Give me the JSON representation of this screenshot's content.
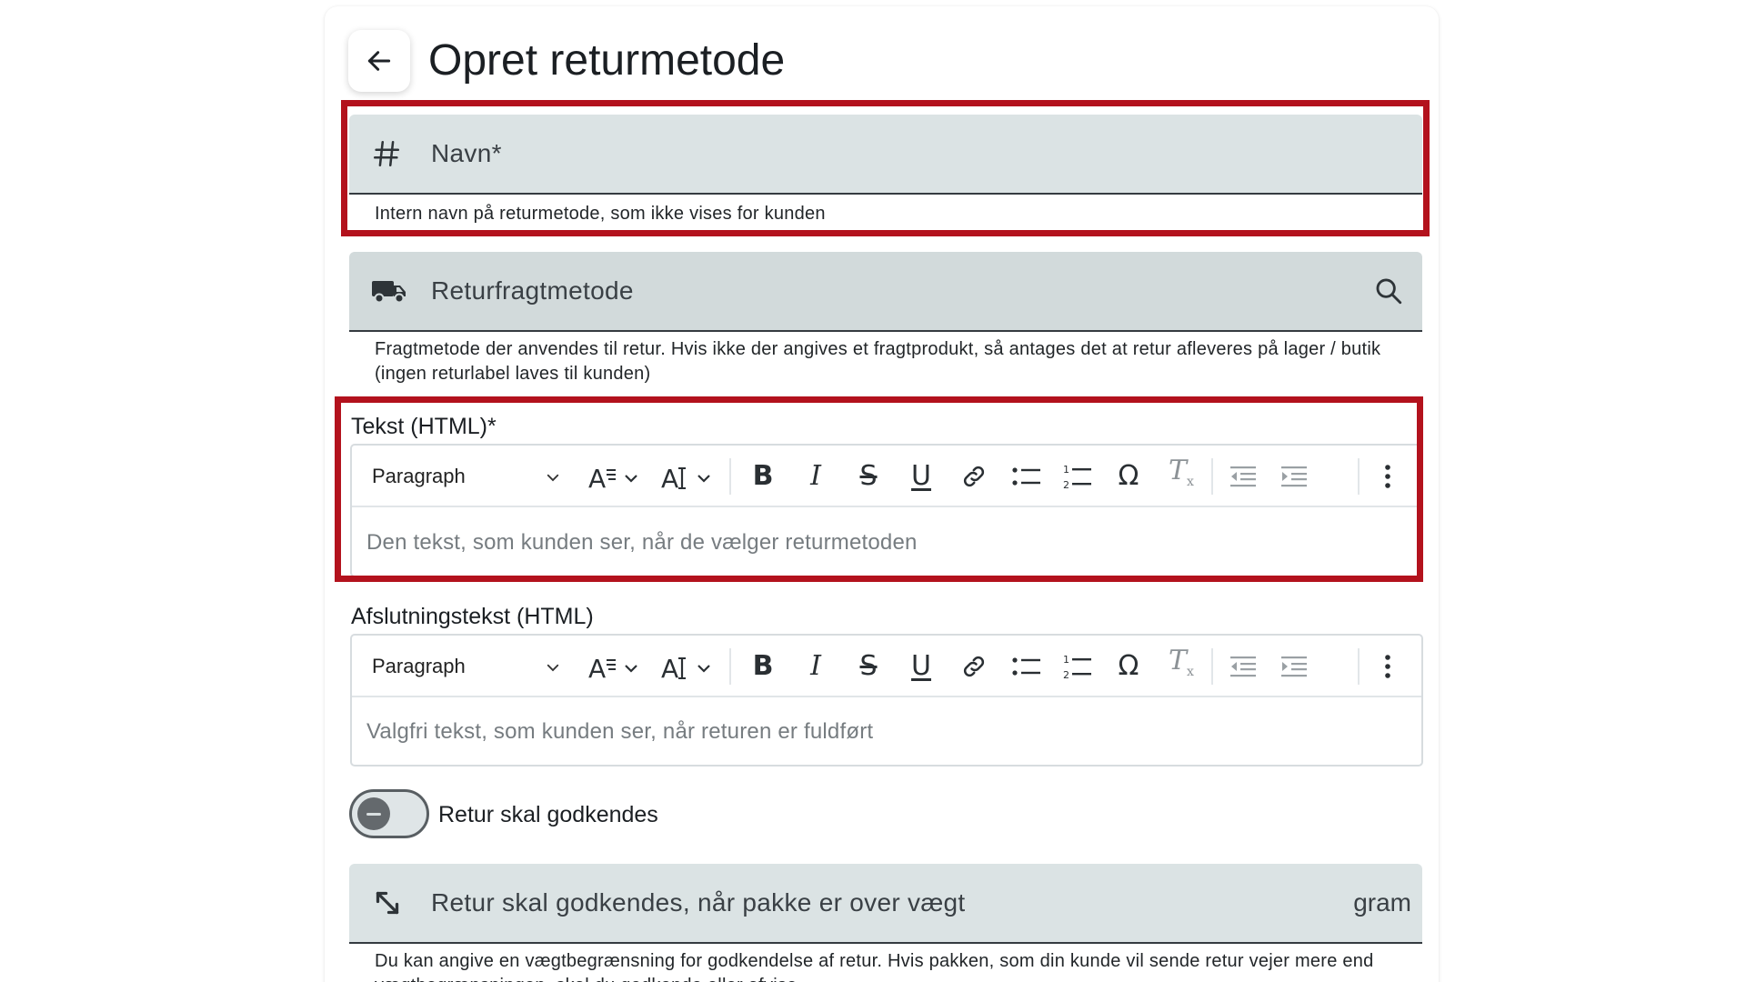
{
  "header": {
    "title": "Opret returmetode"
  },
  "name_field": {
    "label": "Navn*",
    "helper": "Intern navn på returmetode, som ikke vises for kunden"
  },
  "freight_field": {
    "label": "Returfragtmetode",
    "helper": "Fragtmetode der anvendes til retur. Hvis ikke der angives et fragtprodukt, så antages det at retur afleveres på lager / butik (ingen returlabel laves til kunden)"
  },
  "text_editor": {
    "label": "Tekst (HTML)*",
    "block_format": "Paragraph",
    "placeholder": "Den tekst, som kunden ser, når de vælger returmetoden"
  },
  "closing_editor": {
    "label": "Afslutningstekst (HTML)",
    "block_format": "Paragraph",
    "placeholder": "Valgfri tekst, som kunden ser, når returen er fuldført"
  },
  "toolbar_glyphs": {
    "bold": "B",
    "italic": "I",
    "strike": "S",
    "underline": "U",
    "special_char": "Ω",
    "clear_format": "T",
    "clear_format_sub": "x"
  },
  "approval_toggle": {
    "label": "Retur skal godkendes",
    "checked": false
  },
  "weight_field": {
    "label": "Retur skal godkendes, når pakke er over vægt",
    "suffix": "gram",
    "helper": "Du kan angive en vægtbegrænsning for godkendelse af retur. Hvis pakken, som din kunde vil sende retur vejer mere end vægtbegrænsningen, skal du godkende eller afvise"
  },
  "colors": {
    "annotation": "#b3121d",
    "field_background": "#dbe3e4"
  },
  "icons": {
    "back": "arrow-left-icon",
    "name": "hash-icon",
    "freight": "truck-icon",
    "search": "search-icon",
    "weight": "resize-diagonal-icon"
  }
}
